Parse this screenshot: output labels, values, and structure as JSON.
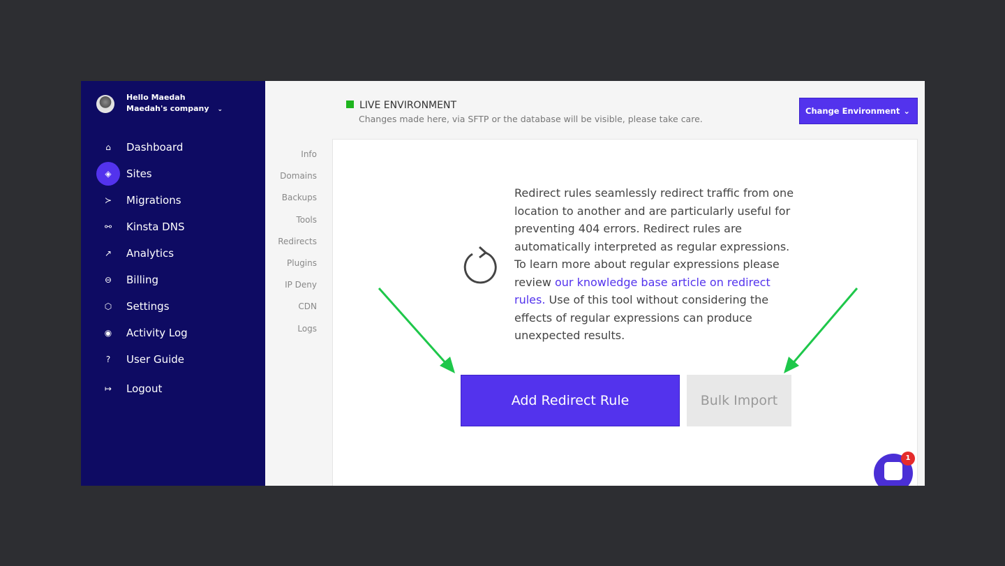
{
  "user": {
    "greeting": "Hello Maedah",
    "company": "Maedah's company"
  },
  "sidebar": {
    "items": [
      {
        "label": "Dashboard",
        "icon": "home-icon",
        "glyph": "⌂"
      },
      {
        "label": "Sites",
        "icon": "layers-icon",
        "glyph": "◈",
        "active": true
      },
      {
        "label": "Migrations",
        "icon": "migrations-icon",
        "glyph": "≻"
      },
      {
        "label": "Kinsta DNS",
        "icon": "dns-icon",
        "glyph": "⚯"
      },
      {
        "label": "Analytics",
        "icon": "trend-icon",
        "glyph": "↗"
      },
      {
        "label": "Billing",
        "icon": "billing-icon",
        "glyph": "⊖"
      },
      {
        "label": "Settings",
        "icon": "settings-icon",
        "glyph": "⬡"
      },
      {
        "label": "Activity Log",
        "icon": "eye-icon",
        "glyph": "◉"
      },
      {
        "label": "User Guide",
        "icon": "help-icon",
        "glyph": "?"
      },
      {
        "label": "Logout",
        "icon": "logout-icon",
        "glyph": "↦"
      }
    ]
  },
  "env": {
    "title": "LIVE ENVIRONMENT",
    "subtitle": "Changes made here, via SFTP or the database will be visible, please take care.",
    "status_color": "#1eb51e",
    "change_label": "Change Environment"
  },
  "subnav": [
    "Info",
    "Domains",
    "Backups",
    "Tools",
    "Redirects",
    "Plugins",
    "IP Deny",
    "CDN",
    "Logs"
  ],
  "subnav_active": "Redirects",
  "main": {
    "desc_1": "Redirect rules seamlessly redirect traffic from one location to another and are particularly useful for preventing 404 errors. Redirect rules are automatically interpreted as regular expressions. To learn more about regular expressions please review ",
    "link": "our knowledge base article on redirect rules.",
    "desc_2": " Use of this tool without considering the effects of regular expressions can produce unexpected results.",
    "add_label": "Add Redirect Rule",
    "bulk_label": "Bulk Import"
  },
  "chat": {
    "badge": "1"
  },
  "colors": {
    "accent": "#5333ed",
    "sidebar": "#0e0b63",
    "arrow": "#1ec74a"
  }
}
